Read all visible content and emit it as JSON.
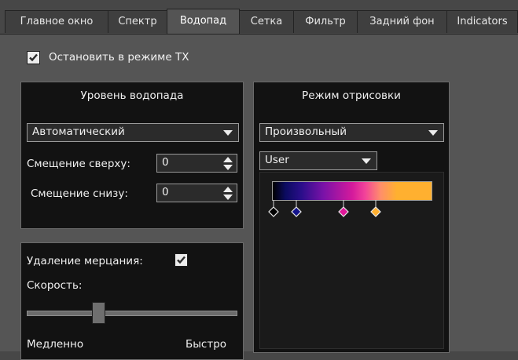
{
  "tabs": [
    {
      "label": "Главное окно"
    },
    {
      "label": "Спектр"
    },
    {
      "label": "Водопад",
      "active": true
    },
    {
      "label": "Сетка"
    },
    {
      "label": "Фильтр"
    },
    {
      "label": "Задний фон"
    },
    {
      "label": "Indicators"
    }
  ],
  "stop_tx": {
    "label": "Остановить в режиме TX",
    "checked": true
  },
  "level_panel": {
    "title": "Уровень водопада",
    "mode_value": "Автоматический",
    "offset_top_label": "Смещение сверху:",
    "offset_top_value": "0",
    "offset_bottom_label": "Смещение снизу:",
    "offset_bottom_value": "0"
  },
  "flicker_panel": {
    "remove_label": "Удаление мерцания:",
    "remove_checked": true,
    "speed_label": "Скорость:",
    "speed_fraction": 0.33,
    "slow_label": "Медленно",
    "fast_label": "Быстро"
  },
  "render_panel": {
    "title": "Режим отрисовки",
    "mode_value": "Произвольный",
    "palette_value": "User",
    "gradient_stop_colors": [
      "#000000",
      "#14148c",
      "#e0189a",
      "#ffb030"
    ],
    "gradient_css": "linear-gradient(to right,#000000 0%,#0b0b60 8%,#2a0e8a 18%,#7a12a8 32%,#d41a9c 50%,#f2429a 58%,#ff8f6a 68%,#ffb030 78%,#ffb030 100%)"
  }
}
